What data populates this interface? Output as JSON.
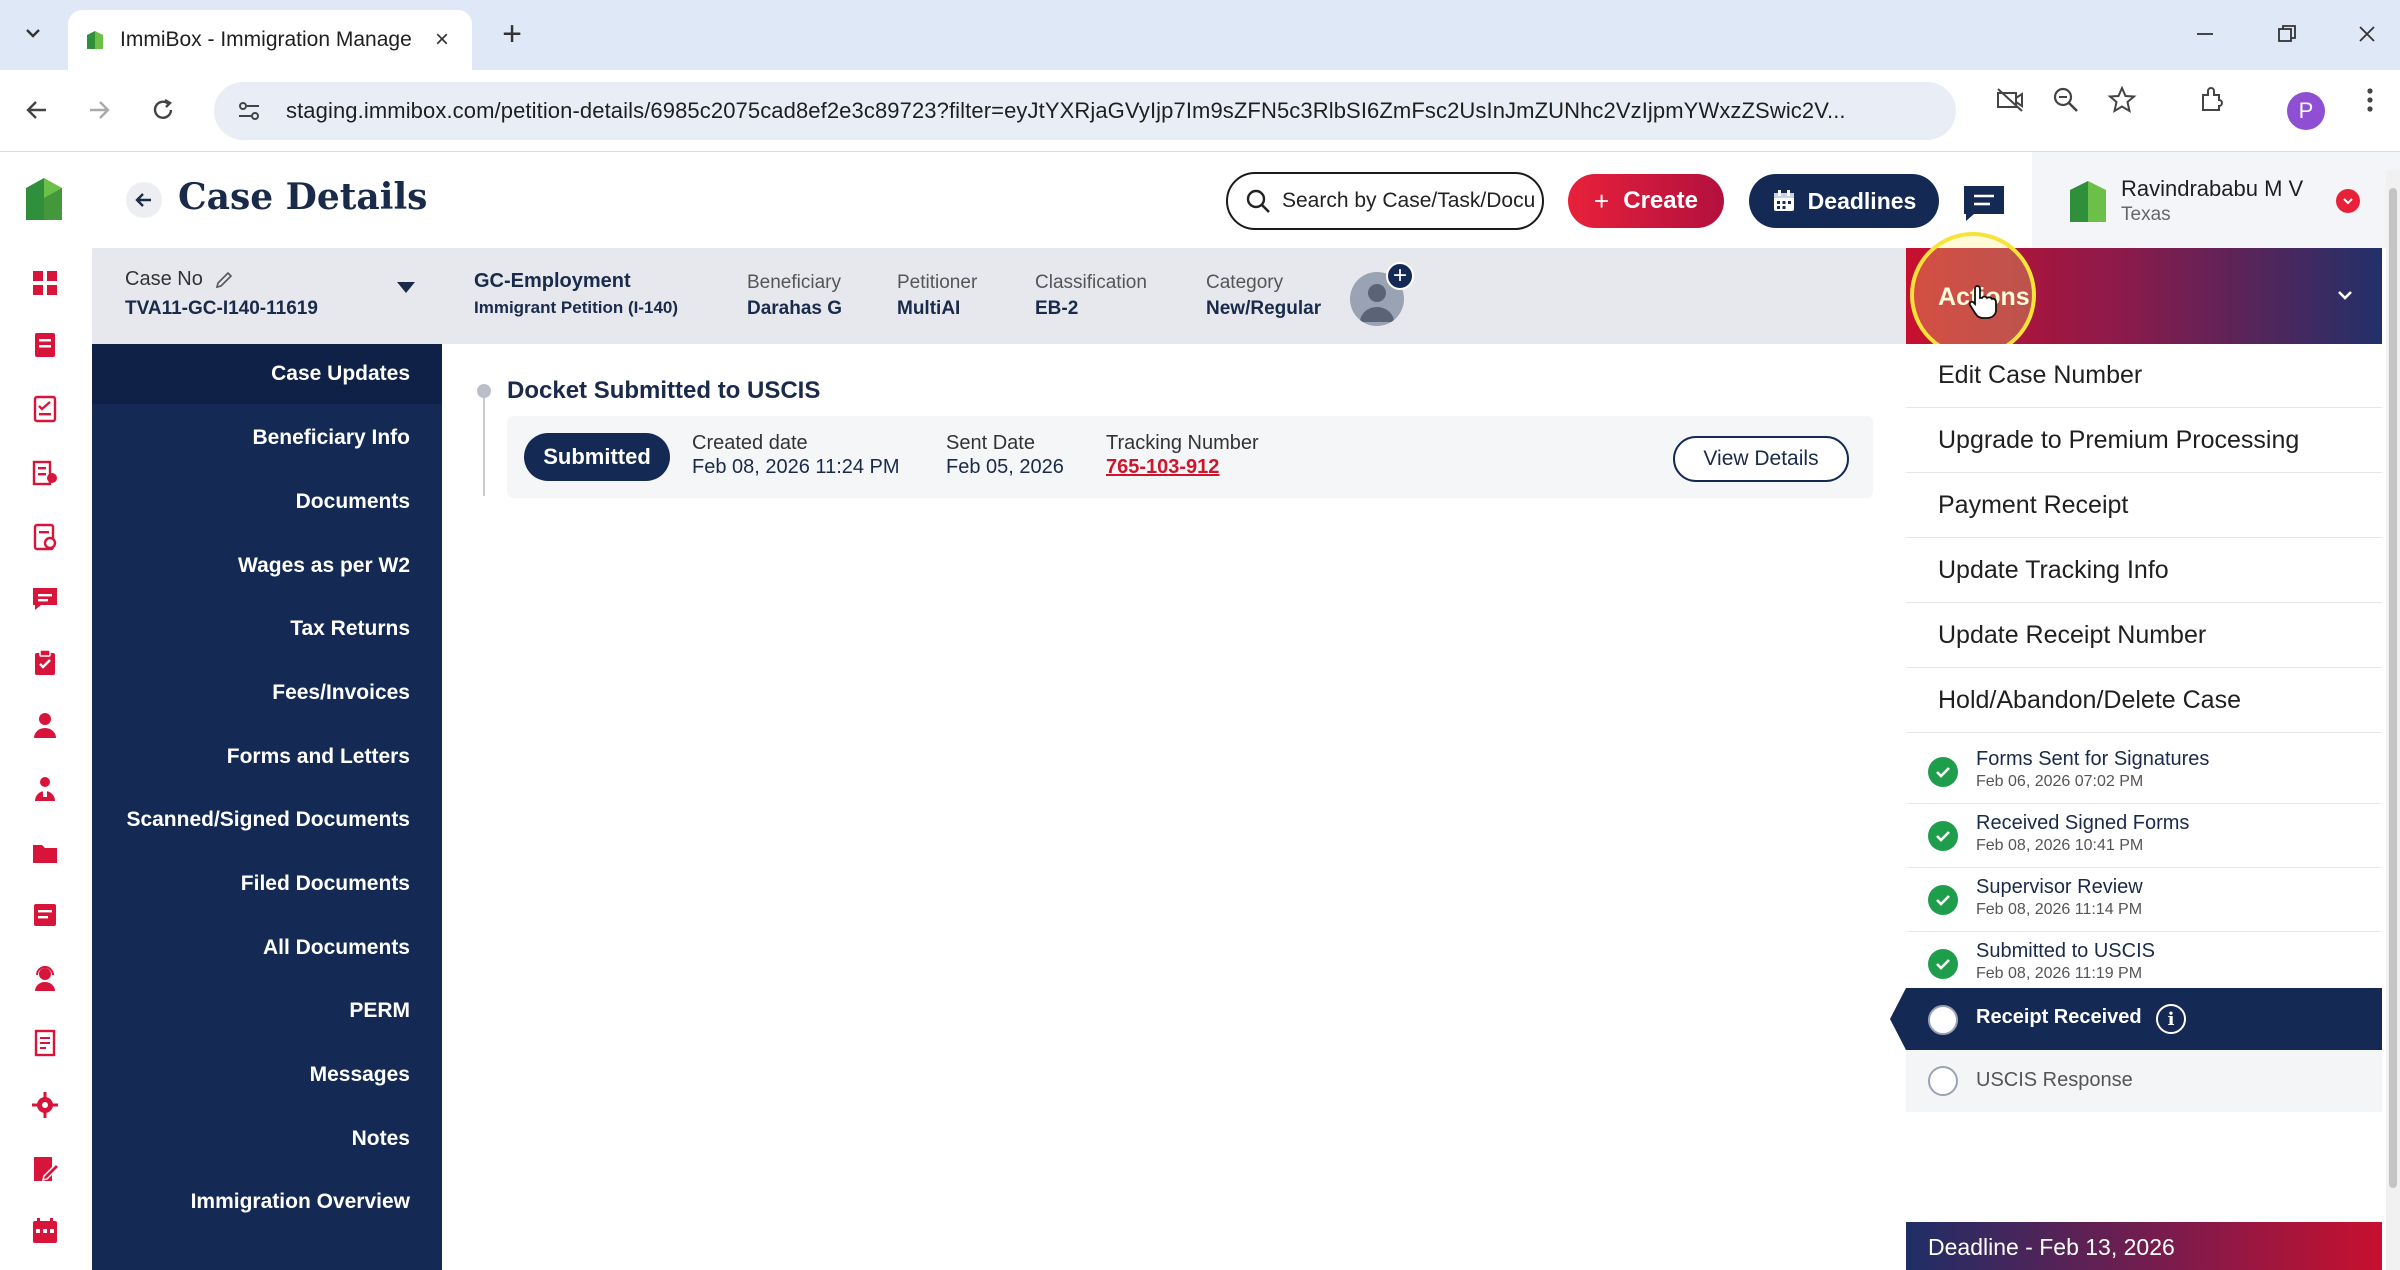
{
  "browser": {
    "tab_title": "ImmiBox - Immigration Manage",
    "url": "staging.immibox.com/petition-details/6985c2075cad8ef2e3c89723?filter=eyJtYXRjaGVyIjp7Im9sZFN5c3RlbSI6ZmFsc2UsInJmZUNhc2VzIjpmYWxzZSwic2V...",
    "profile_initial": "P"
  },
  "header": {
    "title": "Case Details",
    "search_placeholder": "Search by Case/Task/Docu",
    "create_label": "Create",
    "deadlines_label": "Deadlines",
    "user_name": "Ravindrababu M V",
    "user_location": "Texas"
  },
  "case": {
    "case_no_label": "Case No",
    "case_no": "TVA11-GC-I140-11619",
    "type": "GC-Employment",
    "subtype": "Immigrant Petition (I-140)",
    "beneficiary_label": "Beneficiary",
    "beneficiary": "Darahas G",
    "petitioner_label": "Petitioner",
    "petitioner": "MultiAI",
    "classification_label": "Classification",
    "classification": "EB-2",
    "category_label": "Category",
    "category": "New/Regular"
  },
  "nav": {
    "items": [
      "Case Updates",
      "Beneficiary Info",
      "Documents",
      "Wages as per W2",
      "Tax Returns",
      "Fees/Invoices",
      "Forms and Letters",
      "Scanned/Signed Documents",
      "Filed Documents",
      "All Documents",
      "PERM",
      "Messages",
      "Notes",
      "Immigration Overview"
    ]
  },
  "docket": {
    "title": "Docket Submitted to USCIS",
    "status": "Submitted",
    "created_label": "Created date",
    "created_value": "Feb 08, 2026 11:24 PM",
    "sent_label": "Sent Date",
    "sent_value": "Feb 05, 2026",
    "tracking_label": "Tracking Number",
    "tracking_value": "765-103-912",
    "view_details_label": "View Details"
  },
  "actions": {
    "label": "Actions",
    "items": [
      "Edit Case Number",
      "Upgrade to Premium Processing",
      "Payment Receipt",
      "Update Tracking Info",
      "Update Receipt Number",
      "Hold/Abandon/Delete Case"
    ]
  },
  "steps": {
    "completed": [
      {
        "title": "Forms Sent for Signatures",
        "date": "Feb 06, 2026 07:02 PM"
      },
      {
        "title": "Received Signed Forms",
        "date": "Feb 08, 2026 10:41 PM"
      },
      {
        "title": "Supervisor Review",
        "date": "Feb 08, 2026 11:14 PM"
      },
      {
        "title": "Submitted to USCIS",
        "date": "Feb 08, 2026 11:19 PM"
      }
    ],
    "current": "Receipt Received",
    "pending": "USCIS Response"
  },
  "deadline": "Deadline - Feb 13, 2026",
  "colors": {
    "navy": "#142a55",
    "brand_red": "#e8213a",
    "success_green": "#1e9e4a",
    "link_red": "#d0142c"
  }
}
